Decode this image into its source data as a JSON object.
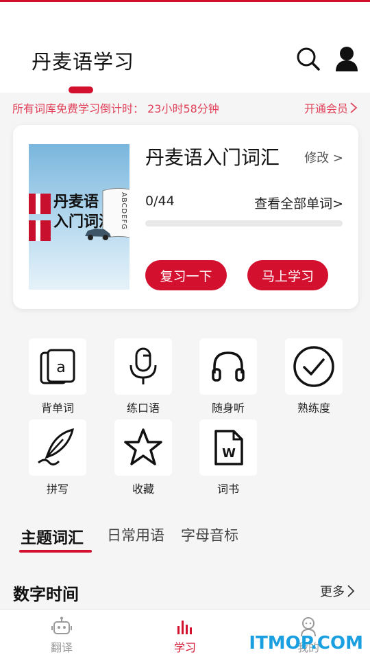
{
  "header": {
    "title": "丹麦语学习",
    "search_icon": "search-icon",
    "profile_icon": "user-icon"
  },
  "promo": {
    "countdown_text": "所有词库免费学习倒计时： 23小时58分钟",
    "vip_link": "开通会员"
  },
  "book_card": {
    "cover_line1": "丹麦语",
    "cover_line2": "入门词汇",
    "cover_spine": "ABCDEFG",
    "title": "丹麦语入门词汇",
    "edit_label": "修改 >",
    "progress_text": "0/44",
    "progress_fraction": 0,
    "view_all_label": "查看全部单词>",
    "review_button": "复习一下",
    "study_button": "马上学习"
  },
  "features": [
    {
      "label": "背单词",
      "icon": "flashcard-icon"
    },
    {
      "label": "练口语",
      "icon": "microphone-icon"
    },
    {
      "label": "随身听",
      "icon": "headphones-icon"
    },
    {
      "label": "熟练度",
      "icon": "check-circle-icon"
    },
    {
      "label": "拼写",
      "icon": "quill-icon"
    },
    {
      "label": "收藏",
      "icon": "star-icon"
    },
    {
      "label": "词书",
      "icon": "word-document-icon"
    }
  ],
  "tabs": [
    {
      "label": "主题词汇",
      "active": true
    },
    {
      "label": "日常用语",
      "active": false
    },
    {
      "label": "字母音标",
      "active": false
    }
  ],
  "section": {
    "title": "数字时间",
    "more_label": "更多"
  },
  "bottom_nav": [
    {
      "label": "翻译",
      "icon": "robot-icon",
      "active": false
    },
    {
      "label": "学习",
      "icon": "bars-icon",
      "active": true
    },
    {
      "label": "我的",
      "icon": "person-icon",
      "active": false
    }
  ],
  "watermark": "ITMOP.COM",
  "colors": {
    "accent": "#d4102f",
    "promo_text": "#e0435a",
    "watermark": "#1aa0e0"
  }
}
